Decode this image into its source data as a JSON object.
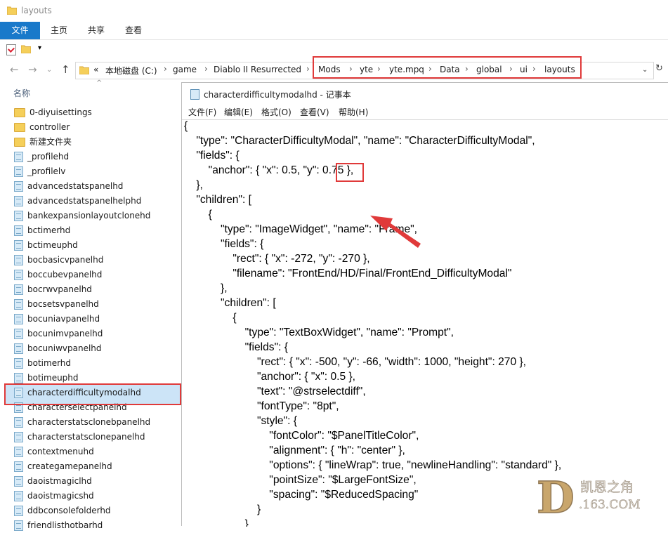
{
  "explorer": {
    "title": "layouts",
    "ribbon_tabs": [
      "文件",
      "主页",
      "共享",
      "查看"
    ],
    "breadcrumb": [
      "«",
      "本地磁盘 (C:)",
      "game",
      "Diablo II Resurrected",
      "Mods",
      "yte",
      "yte.mpq",
      "Data",
      "global",
      "ui",
      "layouts"
    ],
    "column_header": "名称",
    "files": [
      {
        "name": "0-diyuisettings",
        "type": "folder"
      },
      {
        "name": "controller",
        "type": "folder"
      },
      {
        "name": "新建文件夹",
        "type": "folder"
      },
      {
        "name": "_profilehd",
        "type": "file"
      },
      {
        "name": "_profilelv",
        "type": "file"
      },
      {
        "name": "advancedstatspanelhd",
        "type": "file"
      },
      {
        "name": "advancedstatspanelhelphd",
        "type": "file"
      },
      {
        "name": "bankexpansionlayoutclonehd",
        "type": "file"
      },
      {
        "name": "bctimerhd",
        "type": "file"
      },
      {
        "name": "bctimeuphd",
        "type": "file"
      },
      {
        "name": "bocbasicvpanelhd",
        "type": "file"
      },
      {
        "name": "boccubevpanelhd",
        "type": "file"
      },
      {
        "name": "bocrwvpanelhd",
        "type": "file"
      },
      {
        "name": "bocsetsvpanelhd",
        "type": "file"
      },
      {
        "name": "bocuniavpanelhd",
        "type": "file"
      },
      {
        "name": "bocunimvpanelhd",
        "type": "file"
      },
      {
        "name": "bocuniwvpanelhd",
        "type": "file"
      },
      {
        "name": "botimerhd",
        "type": "file"
      },
      {
        "name": "botimeuphd",
        "type": "file"
      },
      {
        "name": "characterdifficultymodalhd",
        "type": "file",
        "selected": true
      },
      {
        "name": "characterselectpanelhd",
        "type": "file"
      },
      {
        "name": "characterstatsclonebpanelhd",
        "type": "file"
      },
      {
        "name": "characterstatsclonepanelhd",
        "type": "file"
      },
      {
        "name": "contextmenuhd",
        "type": "file"
      },
      {
        "name": "creategamepanelhd",
        "type": "file"
      },
      {
        "name": "daoistmagiclhd",
        "type": "file"
      },
      {
        "name": "daoistmagicshd",
        "type": "file"
      },
      {
        "name": "ddbconsolefolderhd",
        "type": "file"
      },
      {
        "name": "friendlisthotbarhd",
        "type": "file"
      }
    ]
  },
  "notepad": {
    "title": "characterdifficultymodalhd - 记事本",
    "menu": [
      "文件(F)",
      "编辑(E)",
      "格式(O)",
      "查看(V)",
      "帮助(H)"
    ],
    "code_lines": [
      "{",
      "    \"type\": \"CharacterDifficultyModal\", \"name\": \"CharacterDifficultyModal\",",
      "    \"fields\": {",
      "        \"anchor\": { \"x\": 0.5, \"y\": 0.75 },",
      "    },",
      "    \"children\": [",
      "        {",
      "            \"type\": \"ImageWidget\", \"name\": \"Frame\",",
      "            \"fields\": {",
      "                \"rect\": { \"x\": -272, \"y\": -270 },",
      "                \"filename\": \"FrontEnd/HD/Final/FrontEnd_DifficultyModal\"",
      "            },",
      "            \"children\": [",
      "                {",
      "                    \"type\": \"TextBoxWidget\", \"name\": \"Prompt\",",
      "                    \"fields\": {",
      "                        \"rect\": { \"x\": -500, \"y\": -66, \"width\": 1000, \"height\": 270 },",
      "                        \"anchor\": { \"x\": 0.5 },",
      "                        \"text\": \"@strselectdiff\",",
      "                        \"fontType\": \"8pt\",",
      "                        \"style\": {",
      "                            \"fontColor\": \"$PanelTitleColor\",",
      "                            \"alignment\": { \"h\": \"center\" },",
      "                            \"options\": { \"lineWrap\": true, \"newlineHandling\": \"standard\" },",
      "                            \"pointSize\": \"$LargeFontSize\",",
      "                            \"spacing\": \"$ReducedSpacing\"",
      "                        }",
      "                    }"
    ]
  },
  "watermark": {
    "letter": "D",
    "text_top": "凯恩之角",
    "text_bottom": ".163.COM"
  },
  "colors": {
    "accent": "#1979ca",
    "highlight": "#e03a3a",
    "selection": "#cce4f7"
  }
}
